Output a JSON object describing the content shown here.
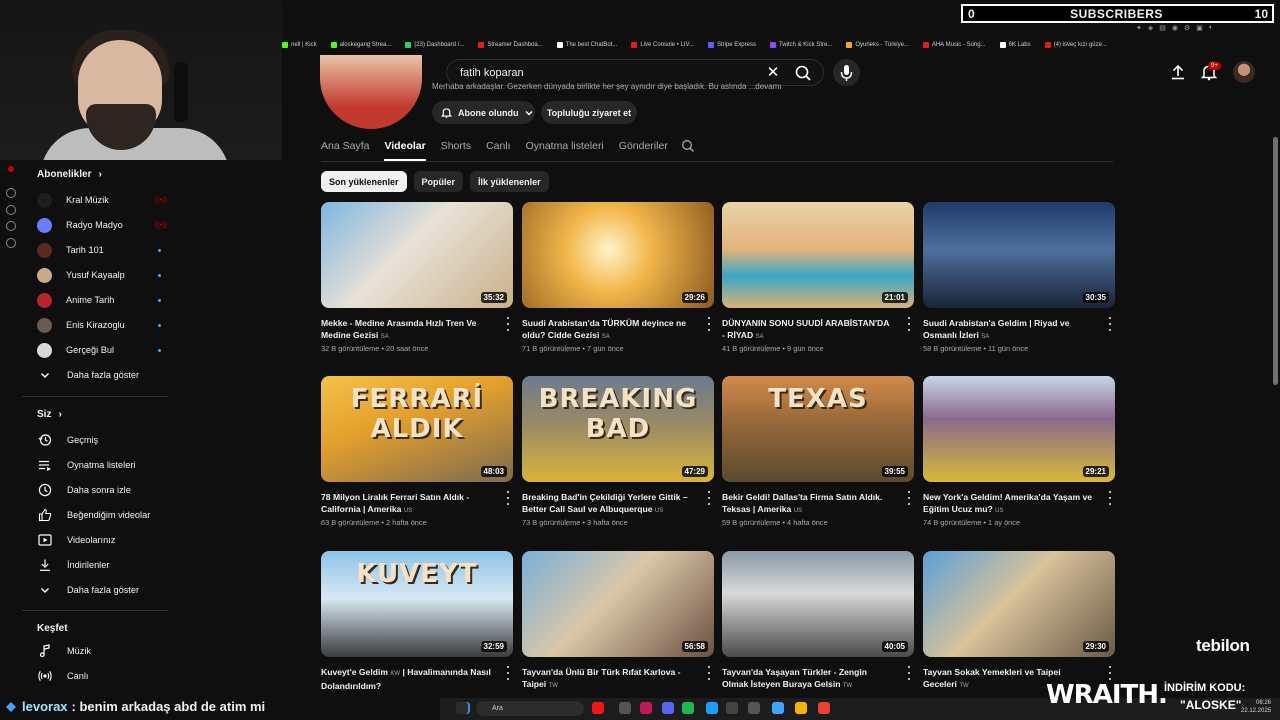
{
  "overlay": {
    "subscriber_count": "0",
    "subscriber_label": "SUBSCRIBERS",
    "subscriber_goal": "10",
    "chat_user": "levorax",
    "chat_message": ": benim arkadaş abd de atim mi",
    "sponsor_brand": "WRAITH.",
    "sponsor_code_label": "İNDİRİM KODU:",
    "sponsor_code": "\"ALOSKE\"",
    "sponsor_logo": "tebilon"
  },
  "bookmarks": [
    {
      "label": "nell | Kick",
      "color": "#53fc18"
    },
    {
      "label": "aloskegang Strea...",
      "color": "#53fc18"
    },
    {
      "label": "(23) Dashboard /...",
      "color": "#2ecc71"
    },
    {
      "label": "Streamer Dashboa...",
      "color": "#e91916"
    },
    {
      "label": "The best ChatBot...",
      "color": "#ffffff"
    },
    {
      "label": "Live Console • LIV...",
      "color": "#e91916"
    },
    {
      "label": "Stripe Express",
      "color": "#635bff"
    },
    {
      "label": "Twitch & Kick Stre...",
      "color": "#9146ff"
    },
    {
      "label": "Oyuneks - Türkiye...",
      "color": "#f5a623"
    },
    {
      "label": "AHA Music - Song...",
      "color": "#e91916"
    },
    {
      "label": "6K Labs",
      "color": "#ffffff"
    },
    {
      "label": "(4) isveç kızı güze...",
      "color": "#e91916"
    }
  ],
  "topbar": {
    "search_query": "fatih koparan",
    "notification_badge": "9+"
  },
  "channel": {
    "description": "Merhaba arkadaşlar. Gezerken dünyada birlikte her şey aynıdır diye başladık. Bu aslında ...devamı",
    "subscribed_label": "Abone olundu",
    "community_label": "Topluluğu ziyaret et"
  },
  "tabs": [
    "Ana Sayfa",
    "Videolar",
    "Shorts",
    "Canlı",
    "Oynatma listeleri",
    "Gönderiler"
  ],
  "active_tab": "Videolar",
  "chips": [
    "Son yüklenenler",
    "Popüler",
    "İlk yüklenenler"
  ],
  "sidebar": {
    "subscriptions_header": "Abonelikler",
    "subscriptions": [
      {
        "label": "Kral Müzik",
        "color": "#1e1e1e",
        "status": "live"
      },
      {
        "label": "Radyo Madyo",
        "color": "#6a7cff",
        "status": "live"
      },
      {
        "label": "Tarih 101",
        "color": "#5a2a20",
        "status": "new"
      },
      {
        "label": "Yusuf Kayaalp",
        "color": "#c9a98c",
        "status": "new"
      },
      {
        "label": "Anime Tarih",
        "color": "#b8242b",
        "status": "new"
      },
      {
        "label": "Enis Kirazoglu",
        "color": "#6b5a50",
        "status": "new"
      },
      {
        "label": "Gerçeği Bul",
        "color": "#d8d8d8",
        "status": "new"
      }
    ],
    "subscriptions_more": "Daha fazla göster",
    "you_header": "Siz",
    "you_items": [
      {
        "label": "Geçmiş",
        "icon": "history-icon"
      },
      {
        "label": "Oynatma listeleri",
        "icon": "playlists-icon"
      },
      {
        "label": "Daha sonra izle",
        "icon": "watch-later-icon"
      },
      {
        "label": "Beğendiğim videolar",
        "icon": "like-icon"
      },
      {
        "label": "Videolarınız",
        "icon": "your-videos-icon"
      },
      {
        "label": "İndirilenler",
        "icon": "download-icon"
      },
      {
        "label": "Daha fazla göster",
        "icon": "chevron-down-icon"
      }
    ],
    "explore_header": "Keşfet",
    "explore_items": [
      {
        "label": "Müzik",
        "icon": "music-icon"
      },
      {
        "label": "Canlı",
        "icon": "live-icon"
      }
    ]
  },
  "videos": [
    {
      "title": "Mekke - Medine Arasında Hızlı Tren Ve Medine Gezisi",
      "flag": "SA",
      "views": "32 B görüntüleme",
      "age": "20 saat önce",
      "duration": "35:32",
      "bg": "linear-gradient(135deg,#7fb6e0 0%,#e8e2d6 45%,#c9b08a 100%)",
      "big_text": ""
    },
    {
      "title": "Suudi Arabistan'da TÜRKÜM deyince ne oldu? Cidde Gezisi",
      "flag": "SA",
      "views": "71 B görüntüleme",
      "age": "7 gün önce",
      "duration": "29:26",
      "bg": "radial-gradient(circle at 45% 45%,#fff4c8 0%,#f2b64a 35%,#8a5a1f 100%)",
      "big_text": ""
    },
    {
      "title": "DÜNYANIN SONU SUUDİ ARABİSTAN'DA - RİYAD",
      "flag": "SA",
      "views": "41 B görüntüleme",
      "age": "9 gün önce",
      "duration": "21:01",
      "bg": "linear-gradient(180deg,#e9d4a8 0%,#e2b27a 45%,#3aa6c4 70%,#d9b27a 100%)",
      "big_text": ""
    },
    {
      "title": "Suudi Arabistan'a Geldim | Riyad ve Osmanlı İzleri",
      "flag": "SA",
      "views": "58 B görüntüleme",
      "age": "11 gün önce",
      "duration": "30:35",
      "bg": "linear-gradient(180deg,#1f3b6a 0%,#4e6f9c 45%,#1a2436 100%)",
      "big_text": ""
    },
    {
      "title": "78 Milyon Liralık Ferrari Satın Aldık - California | Amerika",
      "flag": "US",
      "views": "63 B görüntüleme",
      "age": "2 hafta önce",
      "duration": "48:03",
      "bg": "linear-gradient(160deg,#f3c24a 0%,#e4a02c 40%,#7d6b50 100%)",
      "big_text": "FERRARİ ALDIK"
    },
    {
      "title": "Breaking Bad'in Çekildiği Yerlere Gittik – Better Call Saul ve Albuquerque",
      "flag": "US",
      "views": "73 B görüntüleme",
      "age": "3 hafta önce",
      "duration": "47:29",
      "bg": "linear-gradient(180deg,#6b7b8c 0%,#9a8a66 45%,#d9b43a 100%)",
      "big_text": "BREAKING BAD"
    },
    {
      "title": "Bekir Geldi! Dallas'ta Firma Satın Aldık. Teksas | Amerika",
      "flag": "US",
      "views": "59 B görüntüleme",
      "age": "4 hafta önce",
      "duration": "39:55",
      "bg": "linear-gradient(180deg,#d28b4a 0%,#9a6a3a 40%,#5a4a2e 100%)",
      "big_text": "TEXAS"
    },
    {
      "title": "New York'a Geldim! Amerika'da Yaşam ve Eğitim Ucuz mu?",
      "flag": "US",
      "views": "74 B görüntüleme",
      "age": "1 ay önce",
      "duration": "29:21",
      "bg": "linear-gradient(180deg,#c9d6e8 0%,#8a6a8c 40%,#d8b83a 100%)",
      "big_text": ""
    },
    {
      "title": "Kuveyt'e Geldim",
      "flag": "KW",
      "title_suffix": "| Havalimanında Nasıl Dolandırıldım?",
      "views": "",
      "age": "",
      "duration": "32:59",
      "bg": "linear-gradient(180deg,#8ec3ea 0%,#d8e8f2 45%,#3a3a3a 100%)",
      "big_text": "KUVEYT"
    },
    {
      "title": "Tayvan'da Ünlü Bir Türk Rıfat Karlova - Taipei",
      "flag": "TW",
      "views": "",
      "age": "",
      "duration": "56:58",
      "bg": "linear-gradient(135deg,#7ab0d8 0%,#d9c7a8 45%,#6b5040 100%)",
      "big_text": ""
    },
    {
      "title": "Tayvan'da Yaşayan Türkler - Zengin Olmak İsteyen Buraya Gelsin",
      "flag": "TW",
      "views": "",
      "age": "",
      "duration": "40:05",
      "bg": "linear-gradient(180deg,#8a9aa8 0%,#d8d8d8 40%,#4a4a4a 100%)",
      "big_text": ""
    },
    {
      "title": "Tayvan Sokak Yemekleri ve Taipei Geceleri",
      "flag": "TW",
      "views": "",
      "age": "",
      "duration": "29:30",
      "bg": "linear-gradient(135deg,#5aa0d8 0%,#d8c29a 45%,#6a5a48 100%)",
      "big_text": ""
    }
  ],
  "taskbar": {
    "search_placeholder": "Ara",
    "time": "06:26",
    "date": "22.12.2025"
  }
}
